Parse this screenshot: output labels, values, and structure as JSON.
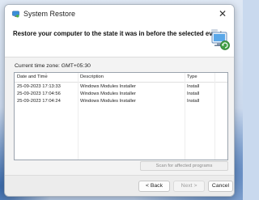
{
  "window": {
    "title": "System Restore",
    "close_glyph": "✕"
  },
  "header": {
    "heading": "Restore your computer to the state it was in before the selected event",
    "icon": "system-restore-icon"
  },
  "timezone": {
    "label": "Current time zone: GMT+05:30"
  },
  "table": {
    "columns": [
      "Date and Time",
      "Description",
      "Type"
    ],
    "rows": [
      {
        "date": "25-09-2023 17:13:33",
        "description": "Windows Modules Installer",
        "type": "Install"
      },
      {
        "date": "25-09-2023 17:04:56",
        "description": "Windows Modules Installer",
        "type": "Install"
      },
      {
        "date": "25-09-2023 17:04:24",
        "description": "Windows Modules Installer",
        "type": "Install"
      }
    ]
  },
  "scan_button": {
    "label": "Scan for affected programs"
  },
  "footer": {
    "back_label": "< Back",
    "next_label": "Next >",
    "cancel_label": "Cancel"
  },
  "colors": {
    "selection": "#cce4f7",
    "accent": "#0067c0"
  }
}
